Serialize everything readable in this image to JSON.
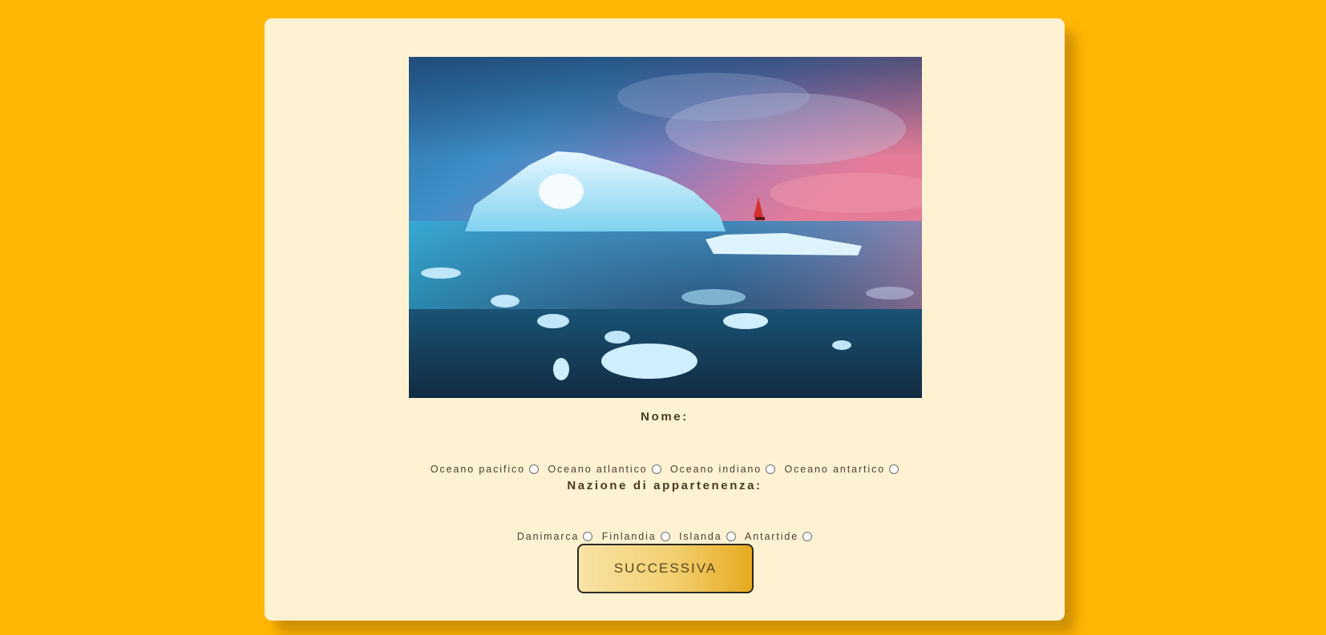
{
  "colors": {
    "page_background": "#FFB703",
    "card_background": "#FFF2D2",
    "button_gradient_start": "#F8E3A6",
    "button_gradient_end": "#E7A91F"
  },
  "quiz": {
    "image_icon": "iceberg-photo",
    "name_label": "Nome:",
    "name_options": [
      {
        "label": "Oceano pacifico"
      },
      {
        "label": "Oceano atlantico"
      },
      {
        "label": "Oceano indiano"
      },
      {
        "label": "Oceano antartico"
      }
    ],
    "nation_label": "Nazione di appartenenza:",
    "nation_options": [
      {
        "label": "Danimarca"
      },
      {
        "label": "Finlandia"
      },
      {
        "label": "Islanda"
      },
      {
        "label": "Antartide"
      }
    ],
    "next_button": "SUCCESSIVA"
  }
}
